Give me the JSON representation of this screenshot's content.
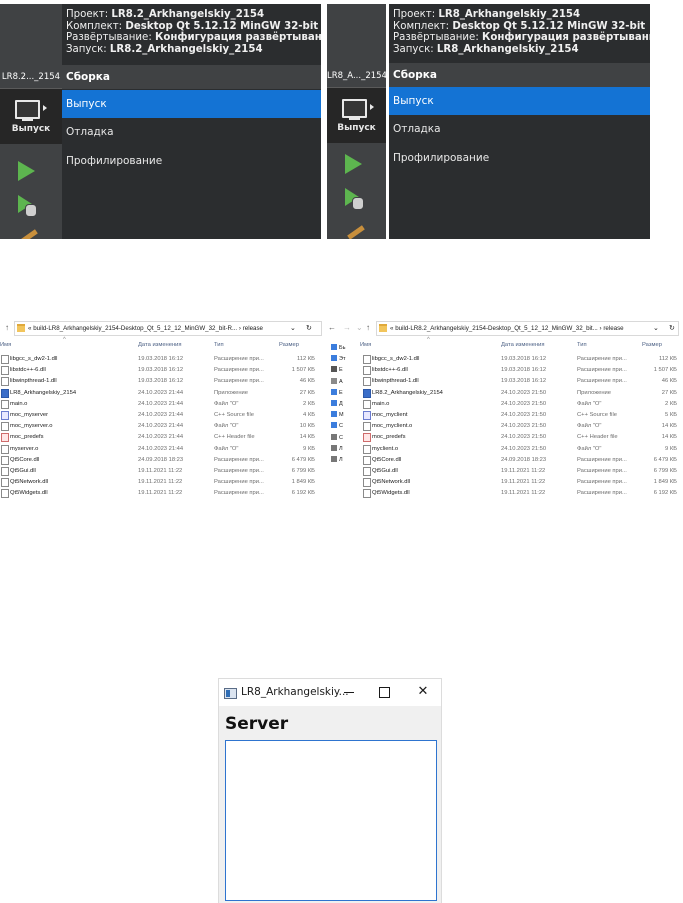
{
  "qt_left": {
    "target_label": "LR8.2..._2154",
    "mode_button_label": "Выпуск",
    "info_lines": [
      {
        "key": "Проект:",
        "value": "LR8.2_Arkhangelskiy_2154"
      },
      {
        "key": "Комплект:",
        "value": "Desktop Qt 5.12.12 MinGW 32-bit"
      },
      {
        "key": "Развёртывание:",
        "value": "Конфигурация развёртывания"
      },
      {
        "key": "Запуск:",
        "value": "LR8.2_Arkhangelskiy_2154"
      }
    ],
    "menu_header": "Сборка",
    "menu_items": [
      "Выпуск",
      "Отладка",
      "Профилирование"
    ],
    "selected_item": "Выпуск"
  },
  "qt_right": {
    "target_label": "LR8_A..._2154",
    "mode_button_label": "Выпуск",
    "info_lines": [
      {
        "key": "Проект:",
        "value": "LR8_Arkhangelskiy_2154"
      },
      {
        "key": "Комплект:",
        "value": "Desktop Qt 5.12.12 MinGW 32-bit"
      },
      {
        "key": "Развёртывание:",
        "value": "Конфигурация развёртывания"
      },
      {
        "key": "Запуск:",
        "value": "LR8_Arkhangelskiy_2154"
      }
    ],
    "menu_header": "Сборка",
    "menu_items": [
      "Выпуск",
      "Отладка",
      "Профилирование"
    ],
    "selected_item": "Выпуск"
  },
  "explorer_left": {
    "path_prefix": "«",
    "path_folder": "build-LR8_Arkhangelskiy_2154-Desktop_Qt_5_12_12_MinGW_32_bit-R...",
    "path_sep": "›",
    "path_last": "release",
    "columns": [
      "Имя",
      "Дата изменения",
      "Тип",
      "Размер"
    ],
    "files": [
      {
        "name": "libgcc_s_dw2-1.dll",
        "date": "19.03.2018 16:12",
        "type": "Расширение при...",
        "size": "112 КБ",
        "icon": "dll"
      },
      {
        "name": "libstdc++-6.dll",
        "date": "19.03.2018 16:12",
        "type": "Расширение при...",
        "size": "1 507 КБ",
        "icon": "dll"
      },
      {
        "name": "libwinpthread-1.dll",
        "date": "19.03.2018 16:12",
        "type": "Расширение при...",
        "size": "46 КБ",
        "icon": "dll"
      },
      {
        "name": "LR8_Arkhangelskiy_2154",
        "date": "24.10.2023 21:44",
        "type": "Приложение",
        "size": "27 КБ",
        "icon": "app"
      },
      {
        "name": "main.o",
        "date": "24.10.2023 21:44",
        "type": "Файл \"O\"",
        "size": "2 КБ",
        "icon": "file"
      },
      {
        "name": "moc_myserver",
        "date": "24.10.2023 21:44",
        "type": "C++ Source file",
        "size": "4 КБ",
        "icon": "cpp"
      },
      {
        "name": "moc_myserver.o",
        "date": "24.10.2023 21:44",
        "type": "Файл \"O\"",
        "size": "10 КБ",
        "icon": "file"
      },
      {
        "name": "moc_predefs",
        "date": "24.10.2023 21:44",
        "type": "C++ Header file",
        "size": "14 КБ",
        "icon": "h"
      },
      {
        "name": "myserver.o",
        "date": "24.10.2023 21:44",
        "type": "Файл \"O\"",
        "size": "9 КБ",
        "icon": "file"
      },
      {
        "name": "Qt5Core.dll",
        "date": "24.09.2018 18:23",
        "type": "Расширение при...",
        "size": "6 479 КБ",
        "icon": "dll"
      },
      {
        "name": "Qt5Gui.dll",
        "date": "19.11.2021 11:22",
        "type": "Расширение при...",
        "size": "6 799 КБ",
        "icon": "dll"
      },
      {
        "name": "Qt5Network.dll",
        "date": "19.11.2021 11:22",
        "type": "Расширение при...",
        "size": "1 849 КБ",
        "icon": "dll"
      },
      {
        "name": "Qt5Widgets.dll",
        "date": "19.11.2021 11:22",
        "type": "Расширение при...",
        "size": "6 192 КБ",
        "icon": "dll"
      }
    ]
  },
  "explorer_right": {
    "path_prefix": "«",
    "path_folder": "build-LR8.2_Arkhangelskiy_2154-Desktop_Qt_5_12_12_MinGW_32_bit...",
    "path_sep": "›",
    "path_last": "release",
    "columns": [
      "Имя",
      "Дата изменения",
      "Тип",
      "Размер"
    ],
    "nav_items": [
      "Бь",
      "Эт",
      "E",
      "A",
      "E",
      "Д",
      "M",
      "C",
      "C",
      "Л",
      "Л"
    ],
    "files": [
      {
        "name": "libgcc_s_dw2-1.dll",
        "date": "19.03.2018 16:12",
        "type": "Расширение при...",
        "size": "112 КБ",
        "icon": "dll"
      },
      {
        "name": "libstdc++-6.dll",
        "date": "19.03.2018 16:12",
        "type": "Расширение при...",
        "size": "1 507 КБ",
        "icon": "dll"
      },
      {
        "name": "libwinpthread-1.dll",
        "date": "19.03.2018 16:12",
        "type": "Расширение при...",
        "size": "46 КБ",
        "icon": "dll"
      },
      {
        "name": "LR8.2_Arkhangelskiy_2154",
        "date": "24.10.2023 21:50",
        "type": "Приложение",
        "size": "27 КБ",
        "icon": "app"
      },
      {
        "name": "main.o",
        "date": "24.10.2023 21:50",
        "type": "Файл \"O\"",
        "size": "2 КБ",
        "icon": "file"
      },
      {
        "name": "moc_myclient",
        "date": "24.10.2023 21:50",
        "type": "C++ Source file",
        "size": "5 КБ",
        "icon": "cpp"
      },
      {
        "name": "moc_myclient.o",
        "date": "24.10.2023 21:50",
        "type": "Файл \"O\"",
        "size": "14 КБ",
        "icon": "file"
      },
      {
        "name": "moc_predefs",
        "date": "24.10.2023 21:50",
        "type": "C++ Header file",
        "size": "14 КБ",
        "icon": "h"
      },
      {
        "name": "myclient.o",
        "date": "24.10.2023 21:50",
        "type": "Файл \"O\"",
        "size": "9 КБ",
        "icon": "file"
      },
      {
        "name": "Qt5Core.dll",
        "date": "24.09.2018 18:23",
        "type": "Расширение при...",
        "size": "6 479 КБ",
        "icon": "dll"
      },
      {
        "name": "Qt5Gui.dll",
        "date": "19.11.2021 11:22",
        "type": "Расширение при...",
        "size": "6 799 КБ",
        "icon": "dll"
      },
      {
        "name": "Qt5Network.dll",
        "date": "19.11.2021 11:22",
        "type": "Расширение при...",
        "size": "1 849 КБ",
        "icon": "dll"
      },
      {
        "name": "Qt5Widgets.dll",
        "date": "19.11.2021 11:22",
        "type": "Расширение при...",
        "size": "6 192 КБ",
        "icon": "dll"
      }
    ]
  },
  "server_window": {
    "title": "LR8_Arkhangelskiy...",
    "minimize": "—",
    "maximize": "",
    "close": "✕",
    "heading": "Server",
    "log_text": ""
  }
}
